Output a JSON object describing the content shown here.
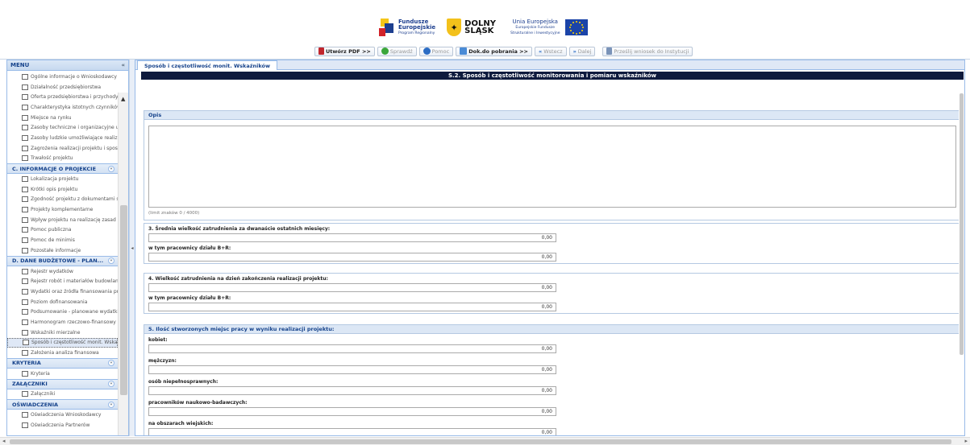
{
  "header": {
    "logo_fe_line1": "Fundusze",
    "logo_fe_line2": "Europejskie",
    "logo_fe_line3": "Program Regionalny",
    "logo_ds_line1": "DOLNY",
    "logo_ds_line2": "ŚLĄSK",
    "logo_ue_line1": "Unia Europejska",
    "logo_ue_line2": "Europejskie Fundusze",
    "logo_ue_line3": "Strukturalne i Inwestycyjne"
  },
  "toolbar": {
    "pdf_label": "Utwórz PDF >>",
    "check_label": "Sprawdź",
    "help_label": "Pomoc",
    "docs_label": "Dok.do pobrania >>",
    "back_label": "Wstecz",
    "next_label": "Dalej",
    "send_label": "Prześlij wniosek do Instytucji"
  },
  "menu": {
    "title": "MENU",
    "collapse_glyph": "«",
    "groups": [
      {
        "label": "",
        "items": [
          "Ogólne informacje o Wnioskodawcy",
          "Działalność przedsiębiorstwa",
          "Oferta przedsiębiorstwa i przychody",
          "Charakterystyka istotnych czynników",
          "Miejsce na rynku",
          "Zasoby techniczne i organizacyjne u",
          "Zasoby ludzkie umożliwiające realiz",
          "Zagrożenia realizacji projektu i spos",
          "Trwałość projektu"
        ]
      },
      {
        "label": "C. INFORMACJE O PROJEKCIE",
        "items": [
          "Lokalizacja projektu",
          "Krótki opis projektu",
          "Zgodność projektu z dokumentami st",
          "Projekty komplementarne",
          "Wpływ projektu na realizację zasad",
          "Pomoc publiczna",
          "Pomoc de minimis",
          "Pozostałe informacje"
        ]
      },
      {
        "label": "D. DANE BUDŻETOWE - PLAN...",
        "items": [
          "Rejestr wydatków",
          "Rejestr robót i materiałów budowlan",
          "Wydatki oraz źródła finansowania pr",
          "Poziom dofinansowania",
          "Podsumowanie - planowane wydatki",
          "Harmonogram rzeczowo-finansowy",
          "Wskaźniki mierzalne",
          "Sposób i częstotliwość monit. Wskaźn",
          "Założenia analiza finansowa"
        ]
      },
      {
        "label": "KRYTERIA",
        "items": [
          "Kryteria"
        ]
      },
      {
        "label": "ZAŁĄCZNIKI",
        "items": [
          "Załączniki"
        ]
      },
      {
        "label": "OŚWIADCZENIA",
        "items": [
          "Oświadczenia Wnioskodawcy",
          "Oświadczenia Partnerów"
        ]
      }
    ],
    "selected_item": "Sposób i częstotliwość monit. Wskaźn"
  },
  "main": {
    "tab_label": "Sposób i częstotliwość monit. Wskaźników",
    "section_title": "S.2. Sposób i częstotliwość monitorowania i pomiaru wskaźników",
    "opis": {
      "header": "Opis",
      "value": "",
      "limit": "(limit znaków 0 / 4000)"
    },
    "q3": {
      "title": "3. Średnia wielkość zatrudnienia za dwanaście ostatnich miesięcy:",
      "value": "0,00",
      "sub_label": "w tym pracownicy działu B+R:",
      "sub_value": "0,00"
    },
    "q4": {
      "title": "4. Wielkość zatrudnienia na dzień zakończenia realizacji projektu:",
      "value": "0,00",
      "sub_label": "w tym pracownicy działu B+R:",
      "sub_value": "0,00"
    },
    "q5": {
      "title": "5. Ilość stworzonych miejsc pracy w wyniku realizacji projektu:",
      "fields": [
        {
          "label": "kobiet:",
          "value": "0,00"
        },
        {
          "label": "mężczyzn:",
          "value": "0,00"
        },
        {
          "label": "osób niepełnosprawnych:",
          "value": "0,00"
        },
        {
          "label": "pracowników naukowo-badawczych:",
          "value": "0,00"
        },
        {
          "label": "na obszarach wiejskich:",
          "value": "0,00"
        }
      ]
    }
  }
}
